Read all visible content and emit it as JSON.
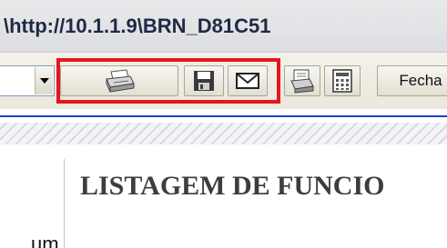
{
  "window": {
    "title": "\\http://10.1.1.9\\BRN_D81C51"
  },
  "toolbar": {
    "icons": [
      "printer-icon",
      "save-disk-icon",
      "email-envelope-icon",
      "print-preview-icon",
      "calculator-icon"
    ],
    "fecha_label": "Fecha"
  },
  "content": {
    "left_label": "um",
    "heading": "LISTAGEM DE FUNCIO"
  },
  "colors": {
    "highlight": "#e8151b",
    "separator": "#1c3fd1",
    "heading": "#3d3d3d"
  }
}
